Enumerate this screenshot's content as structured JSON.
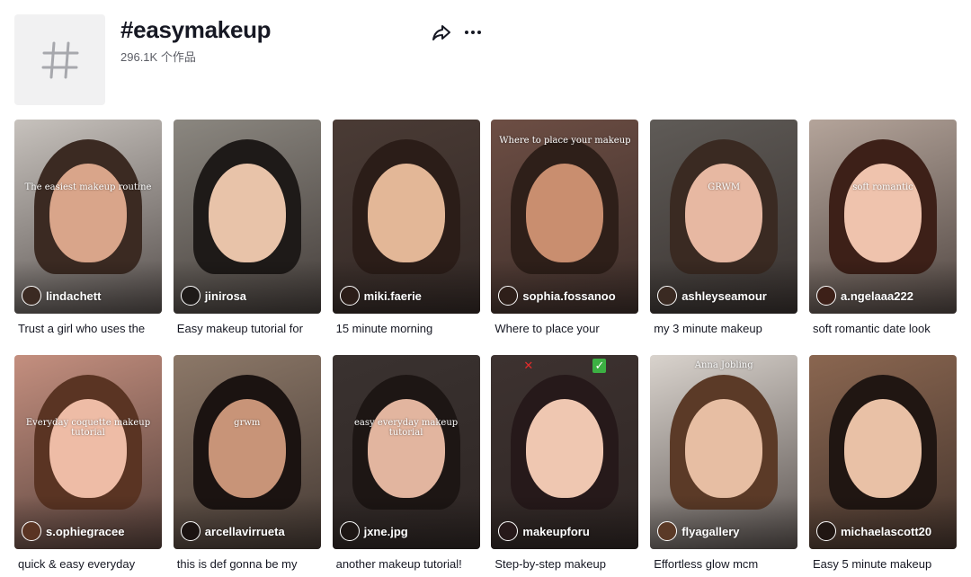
{
  "hashtag": {
    "title": "#easymakeup",
    "count": "296.1K 个作品",
    "icon": "hash-icon"
  },
  "actions": {
    "share_icon": "share-icon",
    "more_icon": "more-icon"
  },
  "videos": [
    {
      "author": "lindachett",
      "caption": "Trust a girl who uses the",
      "overlay": "The easiest makeup routine",
      "bg": "#c7c2bd",
      "hair": "#3b2a22",
      "skin": "#d9a58a"
    },
    {
      "author": "jinirosa",
      "caption": "Easy makeup tutorial for",
      "overlay": "",
      "bg": "#8b8780",
      "hair": "#1e1a18",
      "skin": "#e8c3a9"
    },
    {
      "author": "miki.faerie",
      "caption": "15 minute morning",
      "overlay": "",
      "bg": "#4a3b35",
      "hair": "#2b1d18",
      "skin": "#e3b797"
    },
    {
      "author": "sophia.fossanoo",
      "caption": "Where to place your",
      "overlay": "Where to place your makeup",
      "bg": "#6d4e44",
      "hair": "#2e1f19",
      "skin": "#c98e6f"
    },
    {
      "author": "ashleyseamour",
      "caption": "my 3 minute makeup",
      "overlay": "GRWM",
      "bg": "#5f5b57",
      "hair": "#3a2a22",
      "skin": "#e7b8a2"
    },
    {
      "author": "a.ngelaaa222",
      "caption": "soft romantic date look",
      "overlay": "soft romantic",
      "bg": "#b4a49a",
      "hair": "#3d2018",
      "skin": "#efc3ad"
    },
    {
      "author": "s.ophiegracee",
      "caption": "quick & easy everyday",
      "overlay": "Everyday coquette makeup tutorial",
      "bg": "#c48f7f",
      "hair": "#5a3423",
      "skin": "#eebca6"
    },
    {
      "author": "arcellavirrueta",
      "caption": "this is def gonna be my",
      "overlay": "grwm",
      "bg": "#8c7868",
      "hair": "#1b1311",
      "skin": "#c89478"
    },
    {
      "author": "jxne.jpg",
      "caption": "another makeup tutorial!",
      "overlay": "easy everyday makeup tutorial",
      "bg": "#3a3230",
      "hair": "#1d1614",
      "skin": "#e2b59f"
    },
    {
      "author": "makeupforu",
      "caption": "Step-by-step makeup",
      "overlay": "",
      "bg": "#3d3230",
      "hair": "#26191a",
      "skin": "#efc7b1"
    },
    {
      "author": "flyagallery",
      "caption": "Effortless glow mcm",
      "overlay": "Anna Jobling",
      "bg": "#d9d3cd",
      "hair": "#5b3a27",
      "skin": "#e7bea3"
    },
    {
      "author": "michaelascott20",
      "caption": "Easy 5 minute makeup",
      "overlay": "",
      "bg": "#8a6650",
      "hair": "#201612",
      "skin": "#e9c1a6"
    }
  ]
}
